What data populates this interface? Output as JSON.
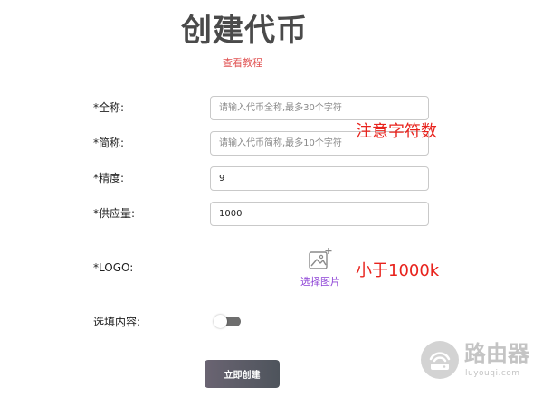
{
  "page": {
    "title": "创建代币",
    "tutorial_link": "查看教程"
  },
  "form": {
    "fullname": {
      "label": "*全称:",
      "value": "",
      "placeholder": "请输入代币全称,最多30个字符"
    },
    "shortname": {
      "label": "*简称:",
      "value": "",
      "placeholder": "请输入代币简称,最多10个字符"
    },
    "precision": {
      "label": "*精度:",
      "value": "9"
    },
    "supply": {
      "label": "*供应量:",
      "value": "1000"
    },
    "logo": {
      "label": "*LOGO:",
      "upload_label": "选择图片"
    },
    "optional": {
      "label": "选填内容:",
      "enabled": false
    },
    "submit_label": "立即创建"
  },
  "annotations": {
    "shortname_note": "注意字符数",
    "logo_note": "小于1000k"
  },
  "watermark": {
    "name": "路由器",
    "url": "luyouqi.com"
  },
  "colors": {
    "link": "#e05252",
    "annotation": "#e8231d",
    "upload_accent": "#8e44d6",
    "button": "#5a5c64"
  },
  "icons": {
    "upload": "image-add-icon",
    "watermark": "router-logo-icon"
  }
}
